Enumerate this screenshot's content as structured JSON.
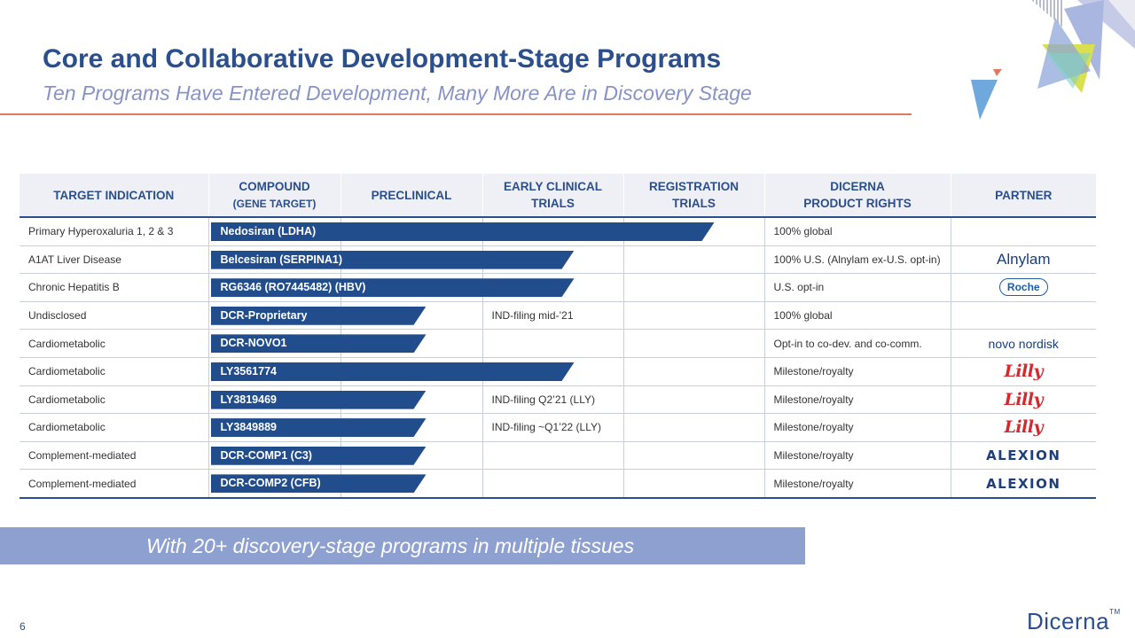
{
  "header": {
    "title": "Core and Collaborative Development-Stage Programs",
    "subtitle": "Ten Programs Have Entered Development, Many More Are in Discovery Stage"
  },
  "table": {
    "columns": {
      "target": "TARGET INDICATION",
      "compound_l1": "COMPOUND",
      "compound_l2": "(GENE TARGET)",
      "preclinical": "PRECLINICAL",
      "early_l1": "EARLY CLINICAL",
      "early_l2": "TRIALS",
      "registration_l1": "REGISTRATION",
      "registration_l2": "TRIALS",
      "rights_l1": "DICERNA",
      "rights_l2": "PRODUCT RIGHTS",
      "partner": "PARTNER"
    },
    "rows": [
      {
        "indication": "Primary Hyperoxaluria 1, 2 & 3",
        "compound": "Nedosiran (LDHA)",
        "note": "",
        "rights": "100% global",
        "partner": "",
        "stage": 3
      },
      {
        "indication": "A1AT Liver Disease",
        "compound": "Belcesiran (SERPINA1)",
        "note": "",
        "rights": "100% U.S. (Alnylam ex-U.S. opt-in)",
        "partner": "Alnylam",
        "stage": 2
      },
      {
        "indication": "Chronic Hepatitis B",
        "compound": "RG6346 (RO7445482) (HBV)",
        "note": "",
        "rights": "U.S. opt-in",
        "partner": "Roche",
        "stage": 2
      },
      {
        "indication": "Undisclosed",
        "compound": "DCR-Proprietary",
        "note": "IND-filing mid-’21",
        "rights": "100% global",
        "partner": "",
        "stage": 1
      },
      {
        "indication": "Cardiometabolic",
        "compound": "DCR-NOVO1",
        "note": "",
        "rights": "Opt-in to co-dev. and co-comm.",
        "partner": "novo nordisk",
        "stage": 1
      },
      {
        "indication": "Cardiometabolic",
        "compound": "LY3561774",
        "note": "",
        "rights": "Milestone/royalty",
        "partner": "Lilly",
        "stage": 2
      },
      {
        "indication": "Cardiometabolic",
        "compound": "LY3819469",
        "note": "IND-filing Q2’21 (LLY)",
        "rights": "Milestone/royalty",
        "partner": "Lilly",
        "stage": 1
      },
      {
        "indication": "Cardiometabolic",
        "compound": "LY3849889",
        "note": "IND-filing ~Q1’22 (LLY)",
        "rights": "Milestone/royalty",
        "partner": "Lilly",
        "stage": 1
      },
      {
        "indication": "Complement-mediated",
        "compound": "DCR-COMP1 (C3)",
        "note": "",
        "rights": "Milestone/royalty",
        "partner": "ALEXION",
        "stage": 1
      },
      {
        "indication": "Complement-mediated",
        "compound": "DCR-COMP2 (CFB)",
        "note": "",
        "rights": "Milestone/royalty",
        "partner": "ALEXION",
        "stage": 1
      }
    ]
  },
  "banner": {
    "text": "With 20+ discovery-stage programs in multiple tissues"
  },
  "footer": {
    "page": "6",
    "brand": "Dicerna",
    "tm": "TM"
  },
  "colors": {
    "title": "#2b4e8c",
    "subtitle": "#8793c4",
    "bar": "#214d8c",
    "banner": "#8da0cf",
    "rule": "#e07a5f"
  }
}
